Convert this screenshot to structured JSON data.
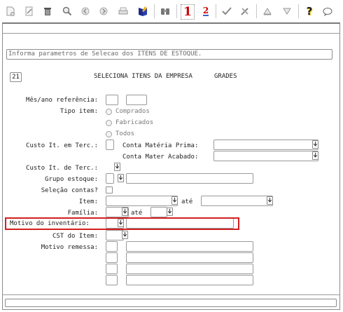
{
  "toolbar": {
    "icons": [
      "new-document-icon",
      "edit-icon",
      "trash-icon",
      "search-icon",
      "previous-record-icon",
      "next-record-icon",
      "print-icon",
      "open-book-icon",
      "binoculars-icon",
      "first-record-icon",
      "last-record-icon",
      "confirm-icon",
      "tools-icon",
      "up-arrow-icon",
      "down-arrow-icon",
      "help-icon",
      "chat-icon"
    ],
    "record_1": "1",
    "record_2": "2",
    "help_glyph": "?"
  },
  "message": "Informa parametros de Selecao dos ITENS DE ESTOQUE.",
  "screen": {
    "number": "21",
    "title": "SELECIONA ITENS DA EMPRESA",
    "subtitle": "GRADES"
  },
  "form": {
    "mes_ano": "Mês/ano referência:",
    "tipo_item": "Tipo item:",
    "tipo_options": [
      "Comprados",
      "Fabricados",
      "Todos"
    ],
    "custo_terc": "Custo It. em Terc.:",
    "conta_materia": "Conta Matéria Prima:",
    "conta_mater_acabado": "Conta Mater Acabado:",
    "custo_de_terc": "Custo It. de Terc.:",
    "grupo_estoque": "Grupo estoque:",
    "selecao_contas": "Seleção contas?",
    "item": "Item:",
    "ate1": "até",
    "familia": "Família:",
    "ate2": "até",
    "motivo_inventario": "Motivo do inventário:",
    "cst_item": "CST do Item:",
    "motivo_remessa": "Motivo remessa:"
  },
  "colors": {
    "highlight": "#d21f1f",
    "record_red": "#cc0000"
  }
}
